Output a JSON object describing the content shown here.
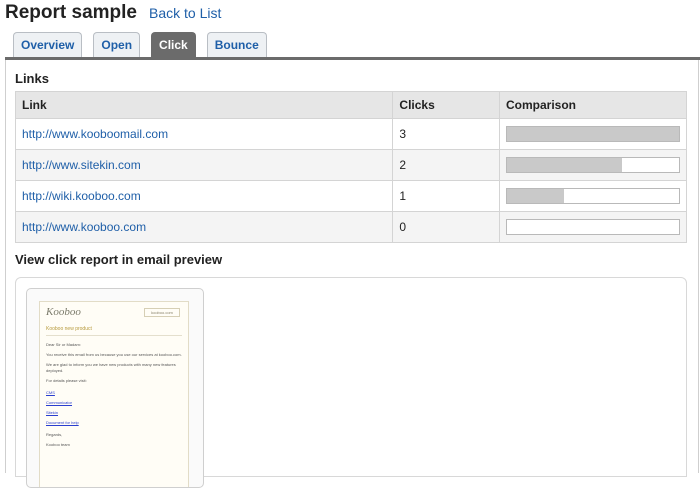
{
  "header": {
    "title": "Report sample",
    "back_link": "Back to List"
  },
  "tabs": [
    {
      "label": "Overview",
      "active": false
    },
    {
      "label": "Open",
      "active": false
    },
    {
      "label": "Click",
      "active": true
    },
    {
      "label": "Bounce",
      "active": false
    }
  ],
  "links_section": {
    "title": "Links",
    "columns": [
      "Link",
      "Clicks",
      "Comparison"
    ],
    "rows": [
      {
        "url": "http://www.kooboomail.com",
        "clicks": "3",
        "comparison": 1.0
      },
      {
        "url": "http://www.sitekin.com",
        "clicks": "2",
        "comparison": 0.667
      },
      {
        "url": "http://wiki.kooboo.com",
        "clicks": "1",
        "comparison": 0.333
      },
      {
        "url": "http://www.kooboo.com",
        "clicks": "0",
        "comparison": 0.0
      }
    ]
  },
  "preview_section": {
    "title": "View click report in email preview",
    "email": {
      "logo": "Kooboo",
      "header_button": "kooboo.com",
      "heading": "Kooboo new product",
      "lines": [
        "Dear Sir or Madam:",
        "You receive this email from us because you use our services at kooboo.com.",
        "We are glad to inform you we have new products with many new features",
        "deployed.",
        "For details please visit:"
      ],
      "links": [
        "CMS",
        "Communicator",
        "Sitekin",
        "Document for help"
      ],
      "closing": [
        "Regards,",
        "Kooboo team"
      ]
    }
  },
  "colors": {
    "accent_link": "#1f5fa8",
    "active_tab": "#6b6b6b",
    "bar_fill": "#c9c9c9"
  }
}
